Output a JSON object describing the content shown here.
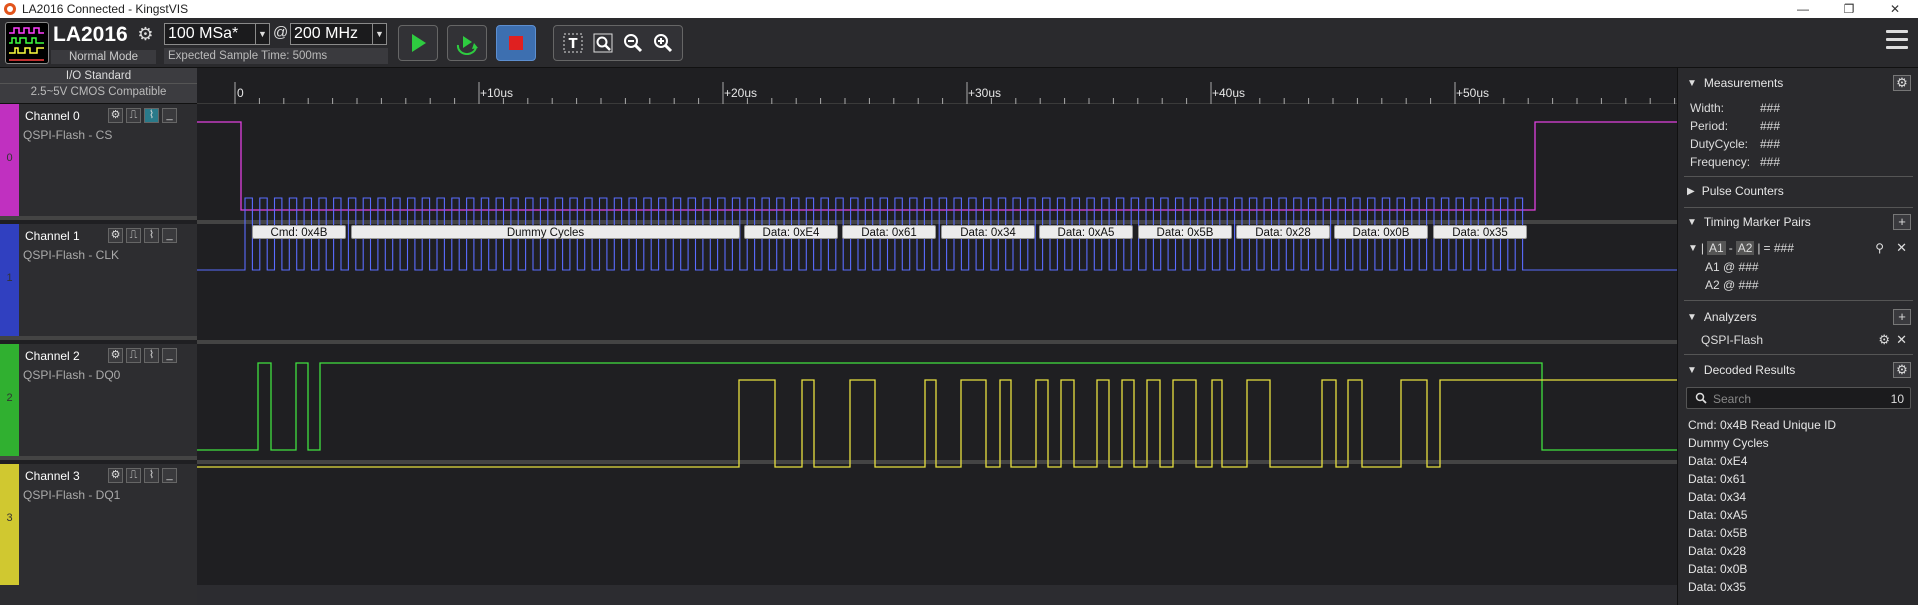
{
  "window": {
    "title": "LA2016 Connected - KingstVIS",
    "controls": [
      "—",
      "❐",
      "✕"
    ]
  },
  "toolbar": {
    "device_name": "LA2016",
    "device_mode": "Normal Mode",
    "sample_rate": "100 MSa*",
    "at_sign": "@",
    "sample_freq": "200 MHz",
    "expected_time": "Expected Sample Time: 500ms",
    "run_color": "#2ecc40",
    "stop_color": "#e02020"
  },
  "io_standard": {
    "title": "I/O Standard",
    "value": "2.5~5V CMOS Compatible"
  },
  "channels": [
    {
      "name": "Channel 0",
      "label": "QSPI-Flash - CS",
      "index": "0",
      "color": "#e040e0",
      "stripe": "#c030c0"
    },
    {
      "name": "Channel 1",
      "label": "QSPI-Flash - CLK",
      "index": "1",
      "color": "#5a6cff",
      "stripe": "#3040c0"
    },
    {
      "name": "Channel 2",
      "label": "QSPI-Flash - DQ0",
      "index": "2",
      "color": "#40e040",
      "stripe": "#30b030"
    },
    {
      "name": "Channel 3",
      "label": "QSPI-Flash - DQ1",
      "index": "3",
      "color": "#e8e040",
      "stripe": "#d0c830"
    }
  ],
  "ruler": {
    "ticks": [
      "0",
      "+10us",
      "+20us",
      "+30us",
      "+40us",
      "+50us"
    ]
  },
  "decoded_boxes": [
    "Cmd: 0x4B",
    "Dummy Cycles",
    "Data: 0xE4",
    "Data: 0x61",
    "Data: 0x34",
    "Data: 0xA5",
    "Data: 0x5B",
    "Data: 0x28",
    "Data: 0x0B",
    "Data: 0x35"
  ],
  "right_panel": {
    "measurements": {
      "title": "Measurements",
      "rows": [
        {
          "label": "Width:",
          "value": "###"
        },
        {
          "label": "Period:",
          "value": "###"
        },
        {
          "label": "DutyCycle:",
          "value": "###"
        },
        {
          "label": "Frequency:",
          "value": "###"
        }
      ]
    },
    "pulse_counters": {
      "title": "Pulse Counters"
    },
    "timing_pairs": {
      "title": "Timing Marker Pairs",
      "pair_a1": "A1",
      "pair_dash": "-",
      "pair_a2": "A2",
      "pair_result": "= ###",
      "a1_line": "A1 @ ###",
      "a2_line": "A2 @ ###"
    },
    "analyzers": {
      "title": "Analyzers",
      "item": "QSPI-Flash"
    },
    "decoded_results": {
      "title": "Decoded Results",
      "search_placeholder": "Search",
      "count": "10",
      "items": [
        "Cmd: 0x4B Read Unique ID",
        "Dummy Cycles",
        "Data: 0xE4",
        "Data: 0x61",
        "Data: 0x34",
        "Data: 0xA5",
        "Data: 0x5B",
        "Data: 0x28",
        "Data: 0x0B",
        "Data: 0x35"
      ]
    }
  }
}
